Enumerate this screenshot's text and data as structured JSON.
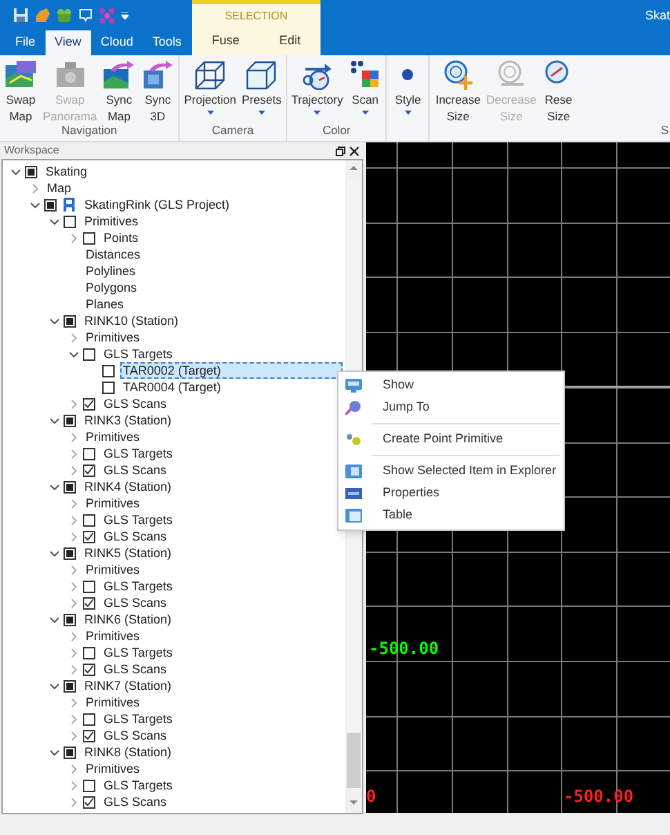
{
  "window": {
    "title": "Skat"
  },
  "tabs": [
    {
      "label": "File",
      "selected": false
    },
    {
      "label": "View",
      "selected": true
    },
    {
      "label": "Cloud",
      "selected": false
    },
    {
      "label": "Tools",
      "selected": false
    }
  ],
  "contextual_tabs": {
    "title": "SELECTION",
    "tabs": [
      {
        "label": "Fuse",
        "selected": false
      },
      {
        "label": "Edit",
        "selected": false
      }
    ]
  },
  "ribbon": {
    "groups": [
      {
        "label": "Navigation",
        "buttons": [
          {
            "lines": [
              "Swap",
              "Map"
            ],
            "disabled": false,
            "dropdown": false
          },
          {
            "lines": [
              "Swap",
              "Panorama"
            ],
            "disabled": true,
            "dropdown": false
          },
          {
            "lines": [
              "Sync",
              "Map"
            ],
            "disabled": false,
            "dropdown": false
          },
          {
            "lines": [
              "Sync",
              "3D"
            ],
            "disabled": false,
            "dropdown": false
          }
        ]
      },
      {
        "label": "Camera",
        "buttons": [
          {
            "lines": [
              "Projection"
            ],
            "disabled": false,
            "dropdown": true
          },
          {
            "lines": [
              "Presets"
            ],
            "disabled": false,
            "dropdown": true
          }
        ]
      },
      {
        "label": "Color",
        "buttons": [
          {
            "lines": [
              "Trajectory"
            ],
            "disabled": false,
            "dropdown": true
          },
          {
            "lines": [
              "Scan"
            ],
            "disabled": false,
            "dropdown": true
          }
        ]
      },
      {
        "buttons": [
          {
            "lines": [
              "Style"
            ],
            "disabled": false,
            "dropdown": true
          }
        ]
      },
      {
        "label": "S",
        "buttons": [
          {
            "lines": [
              "Increase",
              "Size"
            ],
            "disabled": false,
            "dropdown": false
          },
          {
            "lines": [
              "Decrease",
              "Size"
            ],
            "disabled": true,
            "dropdown": false
          },
          {
            "lines": [
              "Rese",
              "Size"
            ],
            "disabled": false,
            "dropdown": false
          }
        ]
      }
    ]
  },
  "workspace": {
    "title": "Workspace",
    "tree": [
      {
        "label": "Skating",
        "expanded": true,
        "checked": true,
        "indeterminate": true,
        "kind": "item",
        "selected": false,
        "children": [
          {
            "label": "Map",
            "expanded": false,
            "kind": "item",
            "selected": false
          },
          {
            "label": "SkatingRink (GLS Project)",
            "expanded": true,
            "checked": true,
            "indeterminate": true,
            "kind": "project",
            "selected": false,
            "children": [
              {
                "label": "Primitives",
                "expanded": true,
                "checked": false,
                "kind": "item",
                "selected": false,
                "children": [
                  {
                    "label": "Points",
                    "expanded": false,
                    "checked": false,
                    "kind": "item",
                    "selected": false
                  },
                  {
                    "label": "Distances",
                    "kind": "item",
                    "selected": false
                  },
                  {
                    "label": "Polylines",
                    "kind": "item",
                    "selected": false
                  },
                  {
                    "label": "Polygons",
                    "kind": "item",
                    "selected": false
                  },
                  {
                    "label": "Planes",
                    "kind": "item",
                    "selected": false
                  }
                ]
              },
              {
                "label": "RINK10 (Station)",
                "expanded": true,
                "checked": true,
                "indeterminate": true,
                "kind": "item",
                "selected": false,
                "children": [
                  {
                    "label": "Primitives",
                    "expanded": false,
                    "kind": "item",
                    "selected": false
                  },
                  {
                    "label": "GLS Targets",
                    "expanded": true,
                    "checked": false,
                    "kind": "item",
                    "selected": false,
                    "children": [
                      {
                        "label": "TAR0002 (Target)",
                        "checked": false,
                        "kind": "item",
                        "selected": true
                      },
                      {
                        "label": "TAR0004 (Target)",
                        "checked": false,
                        "kind": "item",
                        "selected": false
                      }
                    ]
                  },
                  {
                    "label": "GLS Scans",
                    "expanded": false,
                    "checked": true,
                    "indeterminate": false,
                    "kind": "item",
                    "selected": false
                  }
                ]
              },
              {
                "label": "RINK3 (Station)",
                "expanded": true,
                "checked": true,
                "indeterminate": true,
                "kind": "item",
                "selected": false,
                "children": [
                  {
                    "label": "Primitives",
                    "expanded": false,
                    "kind": "item",
                    "selected": false
                  },
                  {
                    "label": "GLS Targets",
                    "expanded": false,
                    "checked": false,
                    "kind": "item",
                    "selected": false
                  },
                  {
                    "label": "GLS Scans",
                    "expanded": false,
                    "checked": true,
                    "indeterminate": false,
                    "kind": "item",
                    "selected": false
                  }
                ]
              },
              {
                "label": "RINK4 (Station)",
                "expanded": true,
                "checked": true,
                "indeterminate": true,
                "kind": "item",
                "selected": false,
                "children": [
                  {
                    "label": "Primitives",
                    "expanded": false,
                    "kind": "item",
                    "selected": false
                  },
                  {
                    "label": "GLS Targets",
                    "expanded": false,
                    "checked": false,
                    "kind": "item",
                    "selected": false
                  },
                  {
                    "label": "GLS Scans",
                    "expanded": false,
                    "checked": true,
                    "indeterminate": false,
                    "kind": "item",
                    "selected": false
                  }
                ]
              },
              {
                "label": "RINK5 (Station)",
                "expanded": true,
                "checked": true,
                "indeterminate": true,
                "kind": "item",
                "selected": false,
                "children": [
                  {
                    "label": "Primitives",
                    "expanded": false,
                    "kind": "item",
                    "selected": false
                  },
                  {
                    "label": "GLS Targets",
                    "expanded": false,
                    "checked": false,
                    "kind": "item",
                    "selected": false
                  },
                  {
                    "label": "GLS Scans",
                    "expanded": false,
                    "checked": true,
                    "indeterminate": false,
                    "kind": "item",
                    "selected": false
                  }
                ]
              },
              {
                "label": "RINK6 (Station)",
                "expanded": true,
                "checked": true,
                "indeterminate": true,
                "kind": "item",
                "selected": false,
                "children": [
                  {
                    "label": "Primitives",
                    "expanded": false,
                    "kind": "item",
                    "selected": false
                  },
                  {
                    "label": "GLS Targets",
                    "expanded": false,
                    "checked": false,
                    "kind": "item",
                    "selected": false
                  },
                  {
                    "label": "GLS Scans",
                    "expanded": false,
                    "checked": true,
                    "indeterminate": false,
                    "kind": "item",
                    "selected": false
                  }
                ]
              },
              {
                "label": "RINK7 (Station)",
                "expanded": true,
                "checked": true,
                "indeterminate": true,
                "kind": "item",
                "selected": false,
                "children": [
                  {
                    "label": "Primitives",
                    "expanded": false,
                    "kind": "item",
                    "selected": false
                  },
                  {
                    "label": "GLS Targets",
                    "expanded": false,
                    "checked": false,
                    "kind": "item",
                    "selected": false
                  },
                  {
                    "label": "GLS Scans",
                    "expanded": false,
                    "checked": true,
                    "indeterminate": false,
                    "kind": "item",
                    "selected": false
                  }
                ]
              },
              {
                "label": "RINK8 (Station)",
                "expanded": true,
                "checked": true,
                "indeterminate": true,
                "kind": "item",
                "selected": false,
                "children": [
                  {
                    "label": "Primitives",
                    "expanded": false,
                    "kind": "item",
                    "selected": false
                  },
                  {
                    "label": "GLS Targets",
                    "expanded": false,
                    "checked": false,
                    "kind": "item",
                    "selected": false
                  },
                  {
                    "label": "GLS Scans",
                    "expanded": false,
                    "checked": true,
                    "indeterminate": false,
                    "kind": "item",
                    "selected": false
                  }
                ]
              }
            ]
          }
        ]
      }
    ]
  },
  "context_menu": {
    "items": [
      {
        "kind": "item",
        "label": "Show"
      },
      {
        "kind": "item",
        "label": "Jump To"
      },
      {
        "kind": "separator"
      },
      {
        "kind": "item",
        "label": "Create Point Primitive"
      },
      {
        "kind": "separator"
      },
      {
        "kind": "item",
        "label": "Show Selected Item in Explorer"
      },
      {
        "kind": "item",
        "label": "Properties"
      },
      {
        "kind": "item",
        "label": "Table"
      }
    ]
  },
  "viewport": {
    "labels": [
      {
        "text": "-500.00",
        "color": "#00ff00"
      },
      {
        "text": "0",
        "color": "#ff2020"
      },
      {
        "text": "-500.00",
        "color": "#ff2020"
      }
    ]
  }
}
